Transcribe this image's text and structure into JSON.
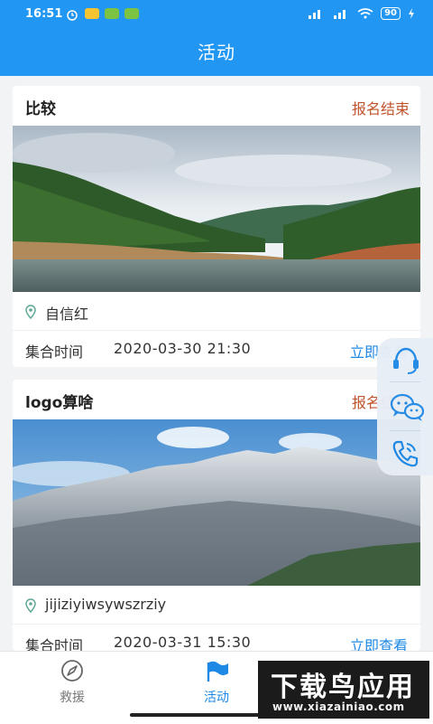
{
  "status_bar": {
    "time": "16:51",
    "battery": "90"
  },
  "header": {
    "title": "活动"
  },
  "activities": [
    {
      "name": "比较",
      "status": "报名结束",
      "location": "自信红",
      "meet_label": "集合时间",
      "meet_time": "2020-03-30 21:30",
      "action": "立即查看"
    },
    {
      "name": "logo算啥",
      "status": "报名结束",
      "location": "jijiziyiwsywszrziy",
      "meet_label": "集合时间",
      "meet_time": "2020-03-31 15:30",
      "action": "立即查看"
    }
  ],
  "floating_actions": [
    "headset-icon",
    "wechat-icon",
    "phone-icon"
  ],
  "tabs": [
    {
      "label": "救援",
      "icon": "compass-icon",
      "active": false
    },
    {
      "label": "活动",
      "icon": "flag-icon",
      "active": true
    }
  ],
  "watermark": {
    "main": "下载鸟应用",
    "url": "www.xiazainiao.com"
  },
  "colors": {
    "primary": "#2196f3",
    "status_ended": "#c0532b",
    "link": "#1e88e5"
  }
}
